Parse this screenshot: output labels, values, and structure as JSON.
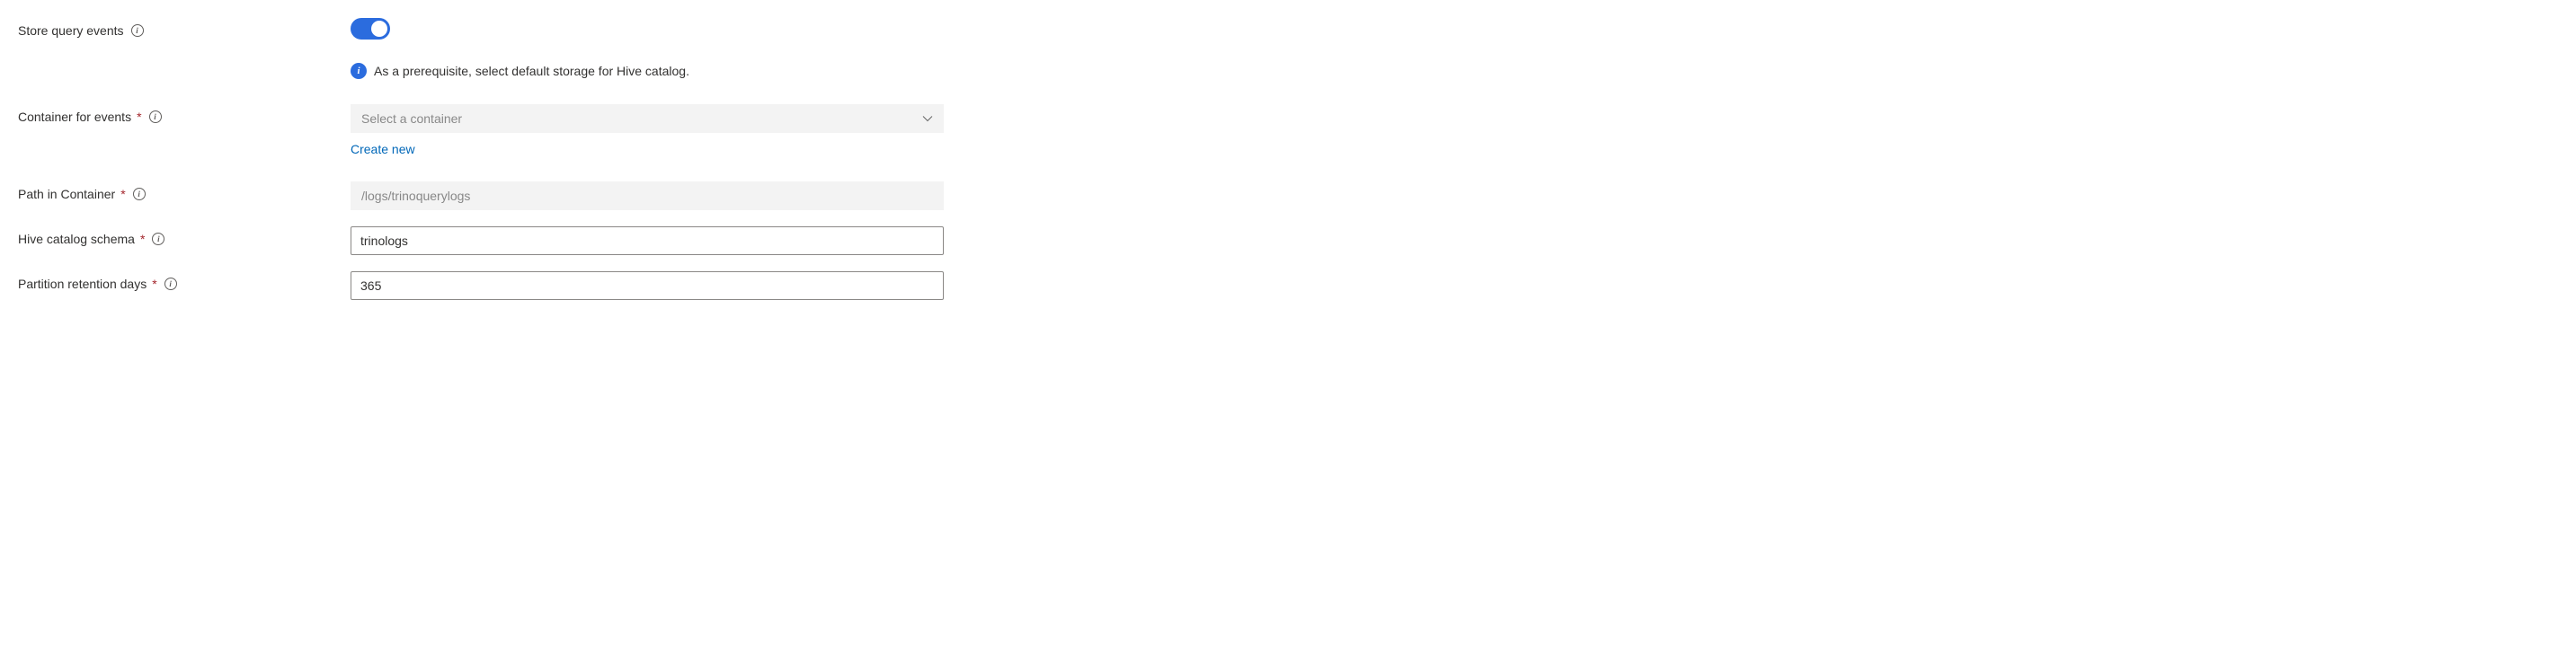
{
  "fields": {
    "storeQueryEvents": {
      "label": "Store query events",
      "enabled": true,
      "infoMessage": "As a prerequisite, select default storage for Hive catalog."
    },
    "containerForEvents": {
      "label": "Container for events",
      "placeholder": "Select a container",
      "createNewLabel": "Create new"
    },
    "pathInContainer": {
      "label": "Path in Container",
      "placeholder": "/logs/trinoquerylogs",
      "value": ""
    },
    "hiveCatalogSchema": {
      "label": "Hive catalog schema",
      "value": "trinologs"
    },
    "partitionRetentionDays": {
      "label": "Partition retention days",
      "value": "365"
    }
  },
  "glyphs": {
    "infoI": "i",
    "required": "*"
  }
}
